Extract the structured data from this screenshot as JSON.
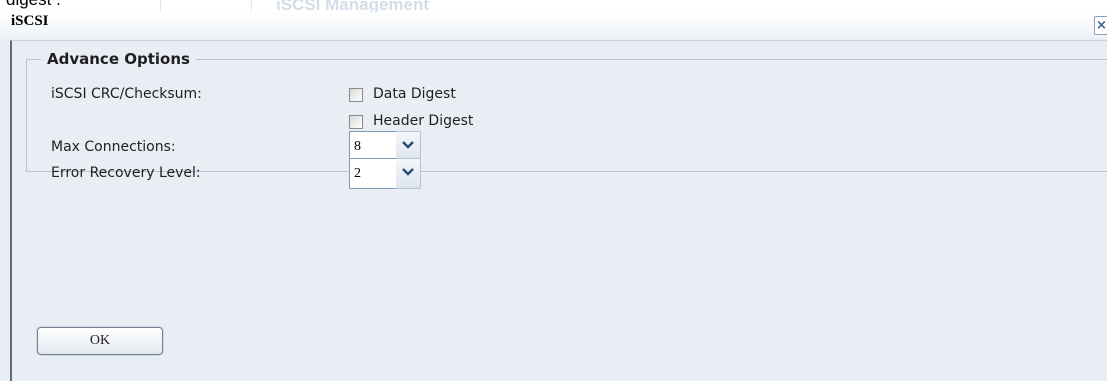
{
  "top_fragment": "digest .",
  "background_heading": "iSCSI Management",
  "window": {
    "title": "iSCSI",
    "close_label": "×"
  },
  "advance_options": {
    "legend": "Advance Options",
    "crc_label": "iSCSI CRC/Checksum:",
    "data_digest": {
      "label": "Data Digest",
      "checked": false
    },
    "header_digest": {
      "label": "Header Digest",
      "checked": false
    },
    "max_connections": {
      "label": "Max Connections:",
      "value": "8"
    },
    "error_recovery": {
      "label": "Error Recovery Level:",
      "value": "2"
    }
  },
  "ok_label": "OK"
}
